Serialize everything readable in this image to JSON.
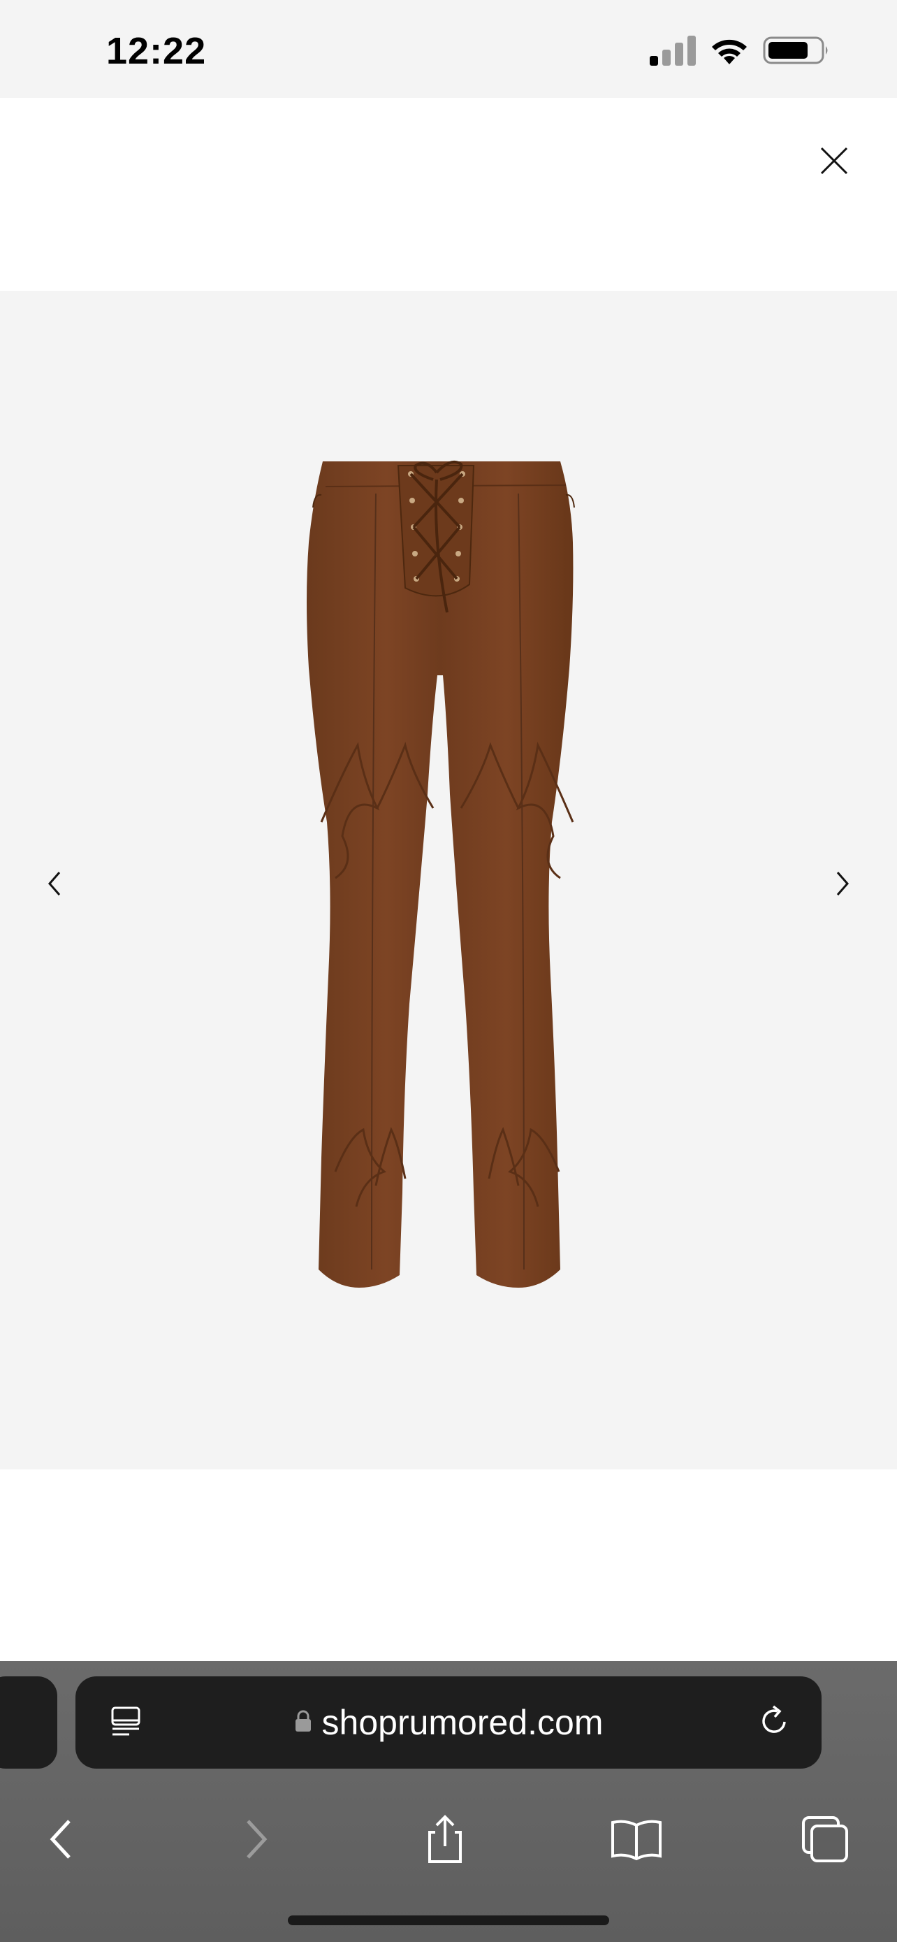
{
  "status_bar": {
    "time": "12:22",
    "signal_icon": "cellular-signal-icon",
    "wifi_icon": "wifi-icon",
    "battery_icon": "battery-icon"
  },
  "modal": {
    "close_icon": "close-icon"
  },
  "gallery": {
    "image_alt": "Brown suede lace-up flared pants",
    "product_color": "#7a4222",
    "prev_icon": "chevron-left-icon",
    "next_icon": "chevron-right-icon"
  },
  "browser": {
    "url": "shoprumored.com",
    "reader_icon": "reader-mode-icon",
    "lock_icon": "lock-icon",
    "reload_icon": "reload-icon",
    "toolbar": {
      "back_icon": "back-icon",
      "forward_icon": "forward-icon",
      "share_icon": "share-icon",
      "bookmarks_icon": "bookmarks-icon",
      "tabs_icon": "tabs-icon"
    }
  }
}
